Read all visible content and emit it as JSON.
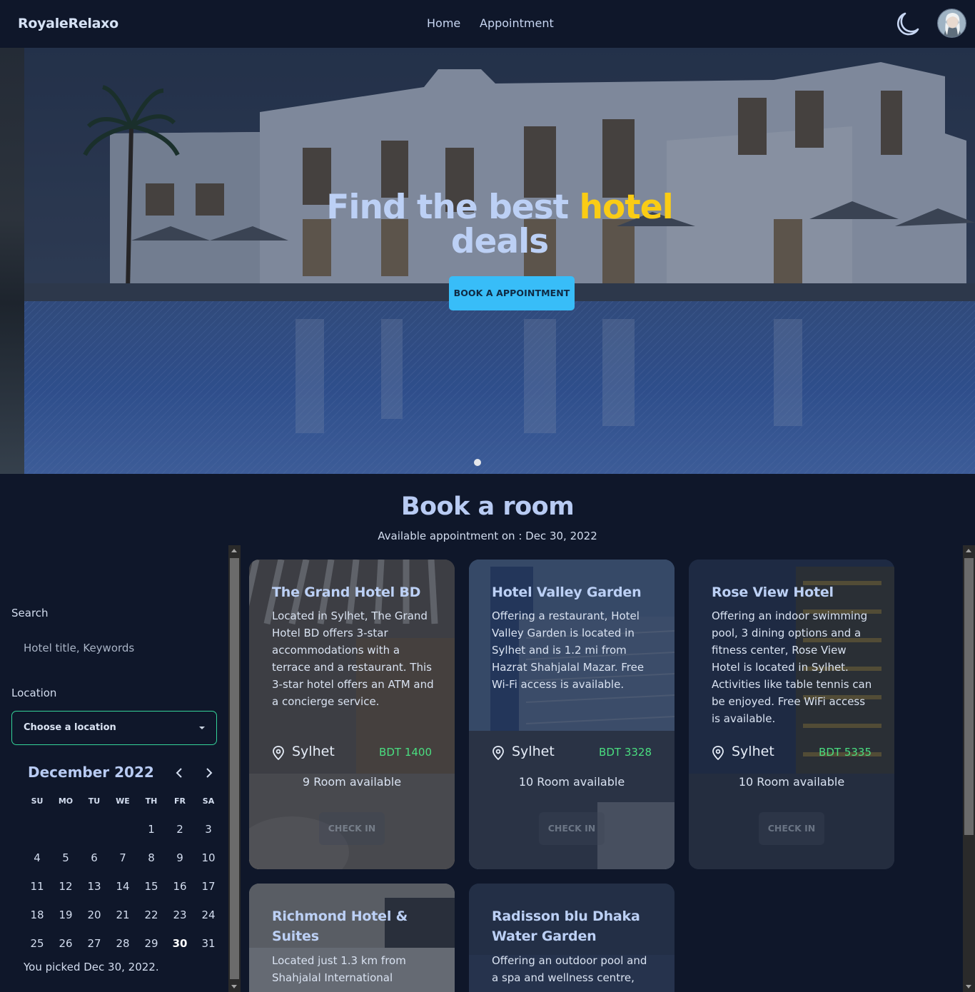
{
  "navbar": {
    "brand": "RoyaleRelaxo",
    "links": [
      "Home",
      "Appointment"
    ],
    "theme_icon": "moon-icon",
    "avatar_icon": "user-avatar"
  },
  "hero": {
    "title_part1": "Find the best ",
    "title_accent": "hotel",
    "title_part2": "deals",
    "button_label": "BOOK A APPOINTMENT",
    "colors": {
      "accent": "#facc15",
      "button": "#38bdf8"
    }
  },
  "booking": {
    "title": "Book a room",
    "subtitle": "Available appointment on : Dec 30, 2022"
  },
  "sidebar": {
    "search_label": "Search",
    "search_placeholder": "Hotel title, Keywords",
    "location_label": "Location",
    "location_value": "Choose a location",
    "calendar": {
      "month": "December 2022",
      "weekdays": [
        "SU",
        "MO",
        "TU",
        "WE",
        "TH",
        "FR",
        "SA"
      ],
      "days": [
        "1",
        "2",
        "3",
        "4",
        "5",
        "6",
        "7",
        "8",
        "9",
        "10",
        "11",
        "12",
        "13",
        "14",
        "15",
        "16",
        "17",
        "18",
        "19",
        "20",
        "21",
        "22",
        "23",
        "24",
        "25",
        "26",
        "27",
        "28",
        "29",
        "30",
        "31"
      ],
      "selected_day": "30"
    },
    "picked_text": "You picked Dec 30, 2022."
  },
  "cards": [
    {
      "title": "The Grand Hotel BD",
      "description": "Located in Sylhet, The Grand Hotel BD offers 3-star accommodations with a terrace and a restaurant. This 3-star hotel offers an ATM and a concierge service.",
      "location": "Sylhet",
      "price": "BDT 1400",
      "rooms": "9 Room available",
      "button": "CHECK IN"
    },
    {
      "title": "Hotel Valley Garden",
      "description": "Offering a restaurant, Hotel Valley Garden is located in Sylhet and is 1.2 mi from Hazrat Shahjalal Mazar. Free Wi-Fi access is available.",
      "location": "Sylhet",
      "price": "BDT 3328",
      "rooms": "10 Room available",
      "button": "CHECK IN"
    },
    {
      "title": "Rose View Hotel",
      "description": "Offering an indoor swimming pool, 3 dining options and a fitness center, Rose View Hotel is located in Sylhet. Activities like table tennis can be enjoyed. Free WiFi access is available.",
      "location": "Sylhet",
      "price": "BDT 5335",
      "rooms": "10 Room available",
      "button": "CHECK IN"
    },
    {
      "title": "Richmond Hotel & Suites",
      "description": "Located just 1.3 km from Shahjalal International"
    },
    {
      "title": "Radisson blu Dhaka Water Garden",
      "description": "Offering an outdoor pool and a spa and wellness centre,"
    }
  ]
}
